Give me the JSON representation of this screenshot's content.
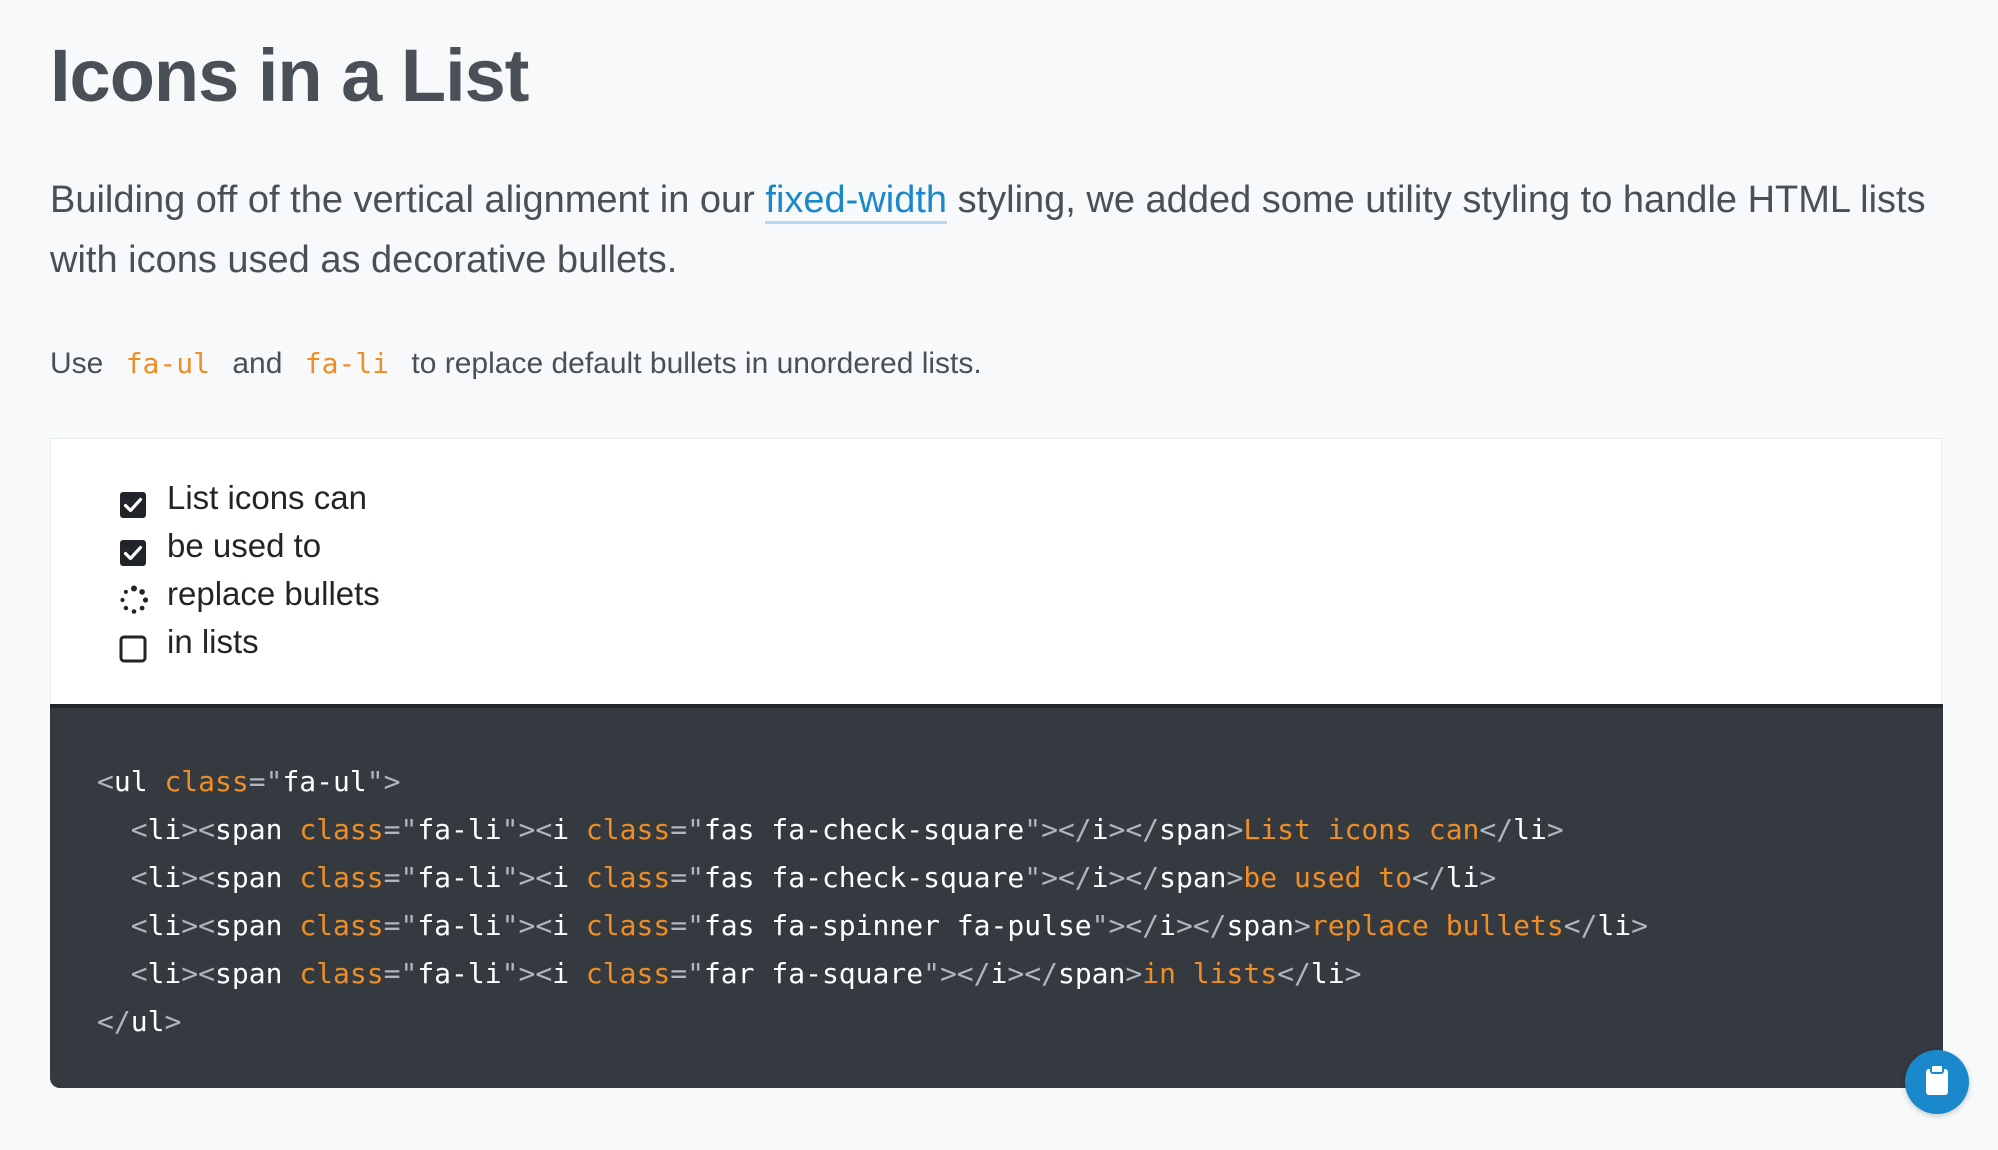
{
  "title": "Icons in a List",
  "lead": {
    "before_link": "Building off of the vertical alignment in our ",
    "link": "fixed-width",
    "after_link": " styling, we added some utility styling to handle HTML lists with icons used as decorative bullets."
  },
  "usage": {
    "prefix": "Use",
    "code1": "fa-ul",
    "middle": "and",
    "code2": "fa-li",
    "suffix": "to replace default bullets in unordered lists."
  },
  "example": {
    "items": [
      {
        "label": "List icons can",
        "icon": "check-square-icon"
      },
      {
        "label": "be used to",
        "icon": "check-square-icon"
      },
      {
        "label": "replace bullets",
        "icon": "spinner-icon"
      },
      {
        "label": "in lists",
        "icon": "square-outline-icon"
      }
    ]
  },
  "code": {
    "open_tag": "ul",
    "attr": "class",
    "ul_class": "fa-ul",
    "li_tag": "li",
    "span_tag": "span",
    "i_tag": "i",
    "li_class": "fa-li",
    "lines": [
      {
        "icon_class": "fas fa-check-square",
        "text": "List icons can"
      },
      {
        "icon_class": "fas fa-check-square",
        "text": "be used to"
      },
      {
        "icon_class": "fas fa-spinner fa-pulse",
        "text": "replace bullets"
      },
      {
        "icon_class": "far fa-square",
        "text": "in lists"
      }
    ]
  },
  "copy_button_icon": "clipboard-icon",
  "colors": {
    "accent_link": "#1c88cc",
    "code_orange": "#f08d24",
    "code_bg": "#343a40"
  }
}
